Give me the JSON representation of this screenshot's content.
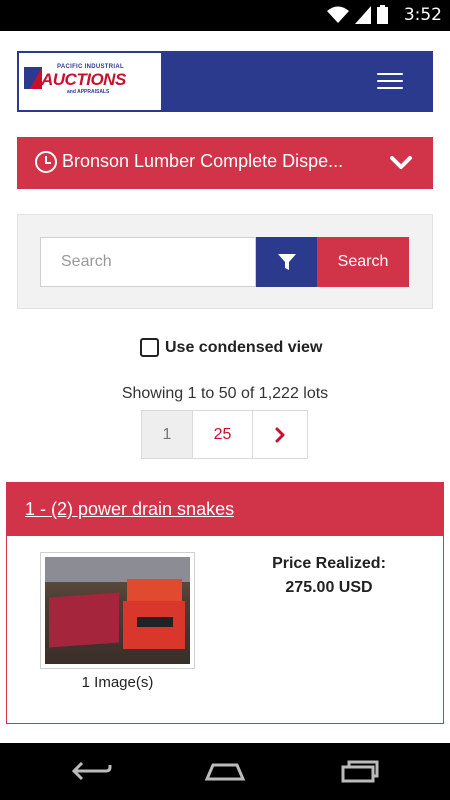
{
  "status_bar": {
    "time": "3:52",
    "icons": [
      "wifi-icon",
      "signal-icon",
      "battery-icon"
    ]
  },
  "header": {
    "logo": {
      "line1": "PACIFIC INDUSTRIAL",
      "line2": "AUCTIONS",
      "line3": "and APPRAISALS"
    },
    "menu_icon": "hamburger-icon"
  },
  "sale": {
    "title": "Bronson Lumber Complete Dispe...",
    "icon": "clock-icon",
    "toggle_icon": "chevron-down-icon"
  },
  "search": {
    "placeholder": "Search",
    "filter_icon": "filter-icon",
    "button_label": "Search"
  },
  "condensed_view": {
    "label": "Use condensed view",
    "checked": false
  },
  "results": {
    "showing_text": "Showing 1 to 50 of 1,222 lots"
  },
  "pagination": {
    "first": "1",
    "per_page": "25",
    "next_icon": "chevron-right-icon"
  },
  "lot": {
    "title": "1 - (2) power drain snakes",
    "images_label": "1 Image(s)",
    "price_label": "Price Realized:",
    "price_value": "275.00 USD"
  },
  "colors": {
    "brand_blue": "#2c3a8e",
    "brand_red": "#d13349"
  },
  "system_nav": [
    "back-icon",
    "home-icon",
    "recents-icon"
  ]
}
